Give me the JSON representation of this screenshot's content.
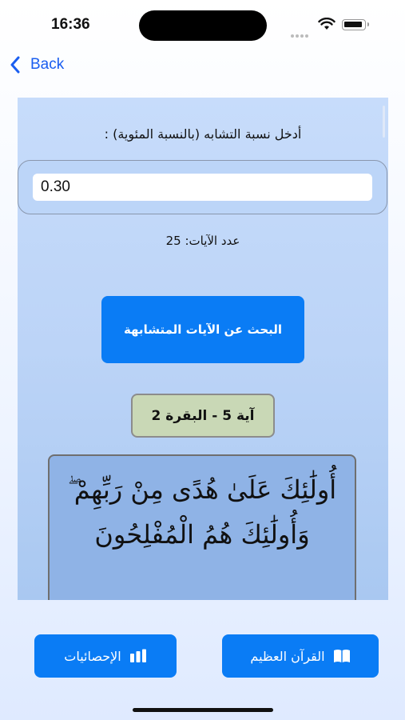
{
  "status_bar": {
    "time": "16:36"
  },
  "nav": {
    "back_label": "Back"
  },
  "form": {
    "prompt": "أدخل نسبة التشابه (بالنسبة المئوية) :",
    "similarity_value": "0.30",
    "verses_count_label": "25 :عدد الآيات"
  },
  "search_button_label": "البحث عن الآيات المتشابهة",
  "result": {
    "reference": "آية 5 - البقرة 2",
    "verse_text": "أُولَٰئِكَ عَلَىٰ هُدًى مِنْ رَبِّهِمْ ۖ وَأُولَٰئِكَ هُمُ الْمُفْلِحُونَ"
  },
  "tab_buttons": {
    "quran_label": "القرآن العظيم",
    "stats_label": "الإحصائيات"
  },
  "colors": {
    "accent": "#0a7cf5",
    "back_link": "#1a5ef0",
    "reference_badge": "#c9d8b6",
    "verse_card": "#8fb3e6"
  },
  "icons": {
    "back": "chevron-left-icon",
    "quran": "book-icon",
    "stats": "chart-bar-icon"
  }
}
